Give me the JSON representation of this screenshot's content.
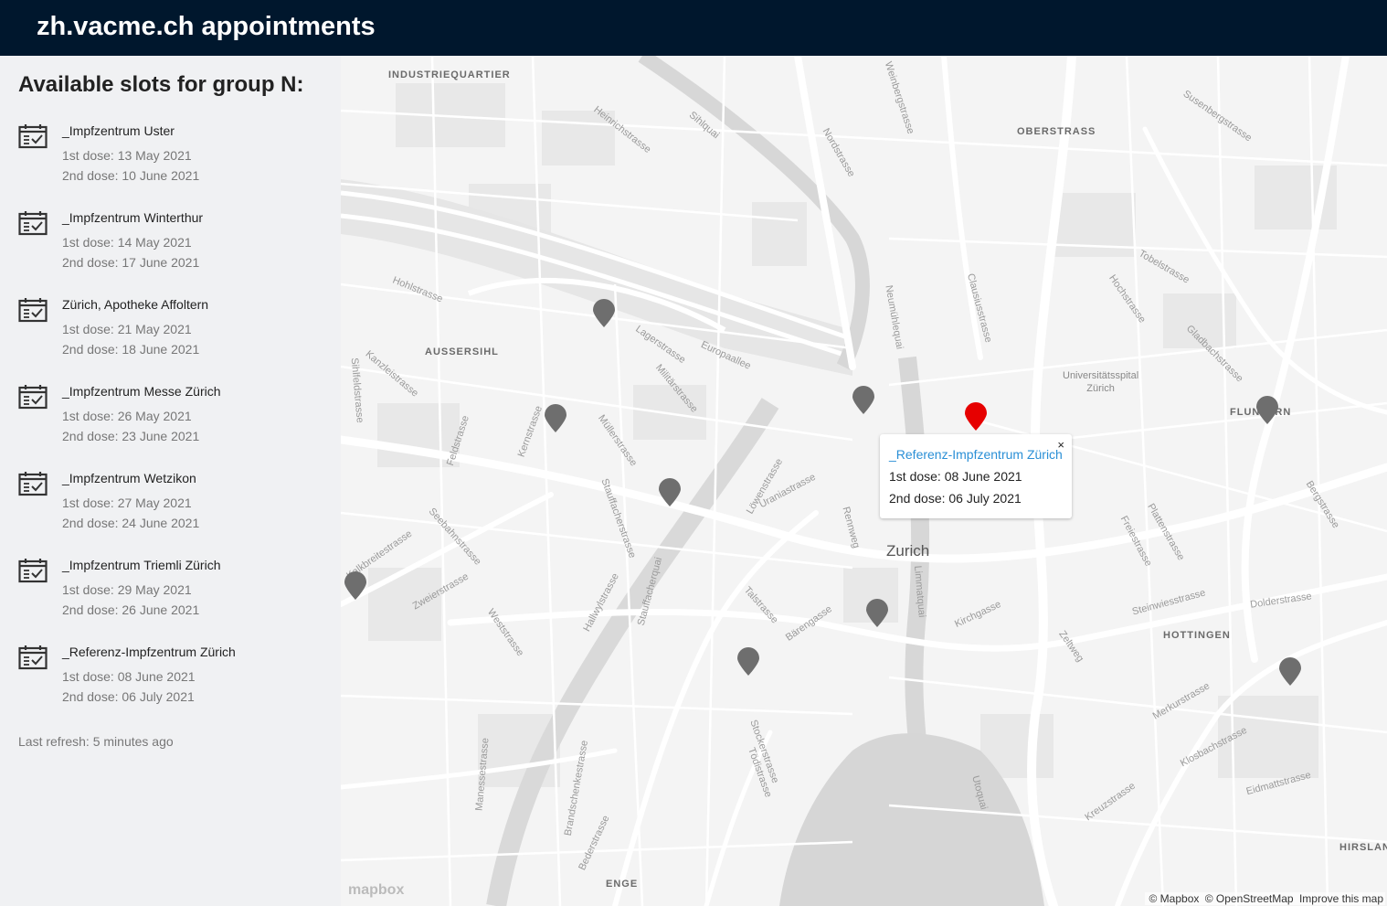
{
  "header": {
    "title": "zh.vacme.ch appointments"
  },
  "sidebar": {
    "heading": "Available slots for group N:",
    "slots": [
      {
        "name": "_Impfzentrum Uster",
        "dose1": "1st dose: 13 May 2021",
        "dose2": "2nd dose: 10 June 2021"
      },
      {
        "name": "_Impfzentrum Winterthur",
        "dose1": "1st dose: 14 May 2021",
        "dose2": "2nd dose: 17 June 2021"
      },
      {
        "name": "Zürich, Apotheke Affoltern",
        "dose1": "1st dose: 21 May 2021",
        "dose2": "2nd dose: 18 June 2021"
      },
      {
        "name": "_Impfzentrum Messe Zürich",
        "dose1": "1st dose: 26 May 2021",
        "dose2": "2nd dose: 23 June 2021"
      },
      {
        "name": "_Impfzentrum Wetzikon",
        "dose1": "1st dose: 27 May 2021",
        "dose2": "2nd dose: 24 June 2021"
      },
      {
        "name": "_Impfzentrum Triemli Zürich",
        "dose1": "1st dose: 29 May 2021",
        "dose2": "2nd dose: 26 June 2021"
      },
      {
        "name": "_Referenz-Impfzentrum Zürich",
        "dose1": "1st dose: 08 June 2021",
        "dose2": "2nd dose: 06 July 2021"
      }
    ],
    "last_refresh": "Last refresh: 5 minutes ago"
  },
  "map": {
    "districts": {
      "industriequartier": "INDUSTRIEQUARTIER",
      "oberstrass": "OBERSTRASS",
      "aussersihl": "AUSSERSIHL",
      "fluntern": "FLUNTERN",
      "hottingen": "HOTTINGEN",
      "enge": "ENGE",
      "hirslanden": "HIRSLAN"
    },
    "city": "Zurich",
    "place_hospital": "Universitätsspital\nZürich",
    "streets": {
      "heinrichstrasse": "Heinrichstrasse",
      "sihlquai": "Sihlquai",
      "nordstrasse": "Nordstrasse",
      "weinbergstrasse": "Weinbergstrasse",
      "lagerstrasse": "Lagerstrasse",
      "europaallee": "Europaallee",
      "militaerstrasse": "Militärstrasse",
      "hohlstrasse": "Hohlstrasse",
      "kanzleistrasse": "Kanzleistrasse",
      "muellerstrasse": "Müllerstrasse",
      "stauffacherstrasse": "Stauffacherstrasse",
      "seebahnstrasse": "Seebahnstrasse",
      "zweierstrasse": "Zweierstrasse",
      "bahnhofstrasse": "Uraniastrasse",
      "loewenstrasse": "Löwenstrasse",
      "limmatquai": "Limmatquai",
      "neumuehlequai": "Neumühlequai",
      "clausiusstrasse": "Clausiusstrasse",
      "universitaetstrasse": "Tobelstrasse",
      "gloriastrasse": "Gladbachstrasse",
      "freiestrasse": "Freiestrasse",
      "plattenstrasse": "Plattenstrasse",
      "steinwiesstrasse": "Steinwiesstrasse",
      "dolderstrasse": "Dolderstrasse",
      "zeltweg": "Zeltweg",
      "kirchgasse": "Kirchgasse",
      "talstrasse": "Talstrasse",
      "baerengasse": "Bärengasse",
      "stockerstrasse": "Stockerstrasse",
      "toedistrasse": "Tödistrasse",
      "utoquai": "Utoquai",
      "kreuzstrasse": "Kreuzstrasse",
      "klosbachstrasse": "Klosbachstrasse",
      "merkurstrasse": "Merkurstrasse",
      "eidmattstrasse": "Eidmattstrasse",
      "badenerstrasse": "Kalkbreitestrasse",
      "brandschenkestrasse": "Brandschenkestrasse",
      "hallwylstrasse": "Hallwylstrasse",
      "stauffacherquai": "Stauffacherquai",
      "feldstrasse": "Feldstrasse",
      "kernstrasse": "Kernstrasse",
      "sihlfeldstrasse": "Sihlfeldstrasse",
      "rennweg": "Rennweg",
      "hochstrasse": "Hochstrasse",
      "bergstrasse": "Bergstrasse",
      "susenbergstrasse": "Susenbergstrasse",
      "westrasse": "Weststrasse",
      "manessestrasse": "Manessestrasse",
      "bederstrasse": "Bederstrasse"
    },
    "popup": {
      "title": "_Referenz-Impfzentrum Zürich",
      "dose1": "1st dose: 08 June 2021",
      "dose2": "2nd dose: 06 July 2021",
      "close": "×"
    },
    "logo": "mapbox",
    "attribution": {
      "mapbox": "© Mapbox",
      "osm": "© OpenStreetMap",
      "improve": "Improve this map"
    },
    "colors": {
      "pin_default": "#6e6e6e",
      "pin_active": "#e60000",
      "link": "#2a8fd6"
    }
  }
}
